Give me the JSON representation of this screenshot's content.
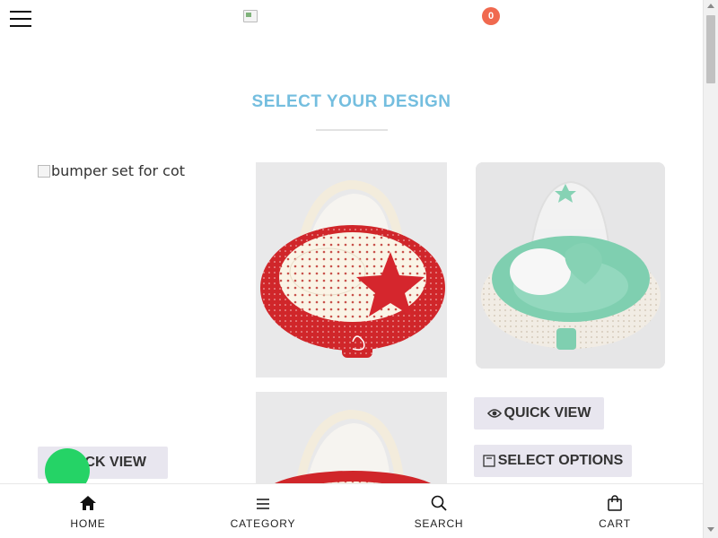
{
  "header": {
    "menu_icon": "hamburger-icon",
    "logo": "broken-logo-image",
    "cart_count": "0",
    "colors": {
      "badge": "#f0694f"
    }
  },
  "section": {
    "title": "SELECT YOUR DESIGN",
    "title_color": "#74bedf"
  },
  "products": [
    {
      "image_alt": "bumper set for cot",
      "image_state": "broken"
    },
    {
      "image": "red-polka-dot-baby-nest-with-star-pillow"
    },
    {
      "image": "mint-green-baby-nest-with-lace-and-canopy"
    },
    {
      "image": "red-polka-dot-baby-nest-with-canopy"
    }
  ],
  "buttons": {
    "quick_view_left": "QUICK VIEW",
    "quick_view_left_visible": "ICK VIEW",
    "quick_view_right": "QUICK VIEW",
    "select_options": "SELECT OPTIONS",
    "eye_icon": "eye-icon",
    "options_icon": "checkbox-icon"
  },
  "floating": {
    "whatsapp_color": "#25d366"
  },
  "bottom_nav": {
    "home": "HOME",
    "category": "CATEGORY",
    "search": "SEARCH",
    "cart": "CART"
  }
}
